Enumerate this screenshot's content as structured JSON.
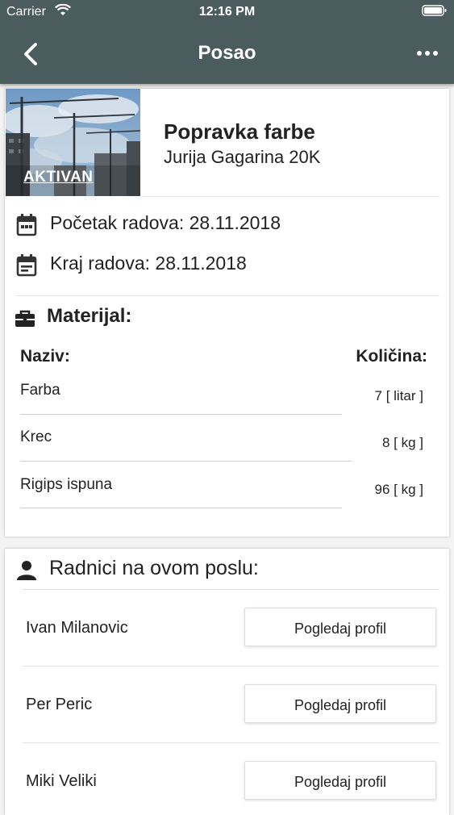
{
  "status_bar": {
    "carrier": "Carrier",
    "time": "12:16 PM"
  },
  "nav": {
    "title": "Posao",
    "back_icon": "chevron-left-icon",
    "more_icon": "more-horizontal-icon"
  },
  "job": {
    "status_badge": "AKTIVAN",
    "title": "Popravka farbe",
    "address": "Jurija Gagarina 20K",
    "start_label": "Početak radova: 28.11.2018",
    "end_label": "Kraj radova: 28.11.2018"
  },
  "materials": {
    "heading": "Materijal:",
    "col_name": "Naziv:",
    "col_qty": "Količina:",
    "items": [
      {
        "name": "Farba",
        "qty": "7 [ litar ]"
      },
      {
        "name": "Krec",
        "qty": "8 [ kg ]"
      },
      {
        "name": "Rigips ispuna",
        "qty": "96 [ kg ]"
      }
    ]
  },
  "workers": {
    "heading": "Radnici na ovom poslu:",
    "button_label": "Pogledaj profil",
    "items": [
      {
        "name": "Ivan Milanovic"
      },
      {
        "name": "Per Peric"
      },
      {
        "name": "Miki Veliki"
      }
    ]
  },
  "colors": {
    "nav_bg": "#4b5c5e",
    "card_bg": "#ffffff",
    "page_bg": "#f3f3f3"
  }
}
